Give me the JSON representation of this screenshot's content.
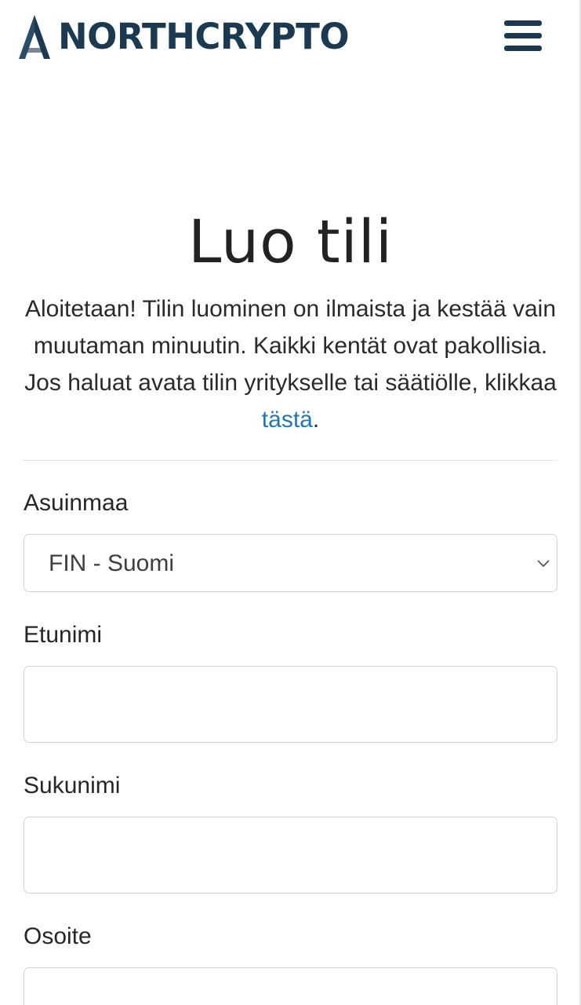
{
  "header": {
    "logo_text": "NORTHCRYPTO",
    "brand_color": "#1b3a52",
    "menu_icon": "hamburger-menu-icon"
  },
  "main": {
    "title": "Luo tili",
    "intro_text": "Aloitetaan! Tilin luominen on ilmaista ja kestää vain muutaman minuutin. Kaikki kentät ovat pakollisia. Jos haluat avata tilin yritykselle tai säätiölle, klikkaa ",
    "intro_link": "tästä",
    "intro_end": ".",
    "link_color": "#1f77b4"
  },
  "form": {
    "country": {
      "label": "Asuinmaa",
      "value": "FIN - Suomi",
      "icon": "chevron-down-icon"
    },
    "first_name": {
      "label": "Etunimi",
      "value": ""
    },
    "last_name": {
      "label": "Sukunimi",
      "value": ""
    },
    "address": {
      "label": "Osoite",
      "value": ""
    }
  }
}
